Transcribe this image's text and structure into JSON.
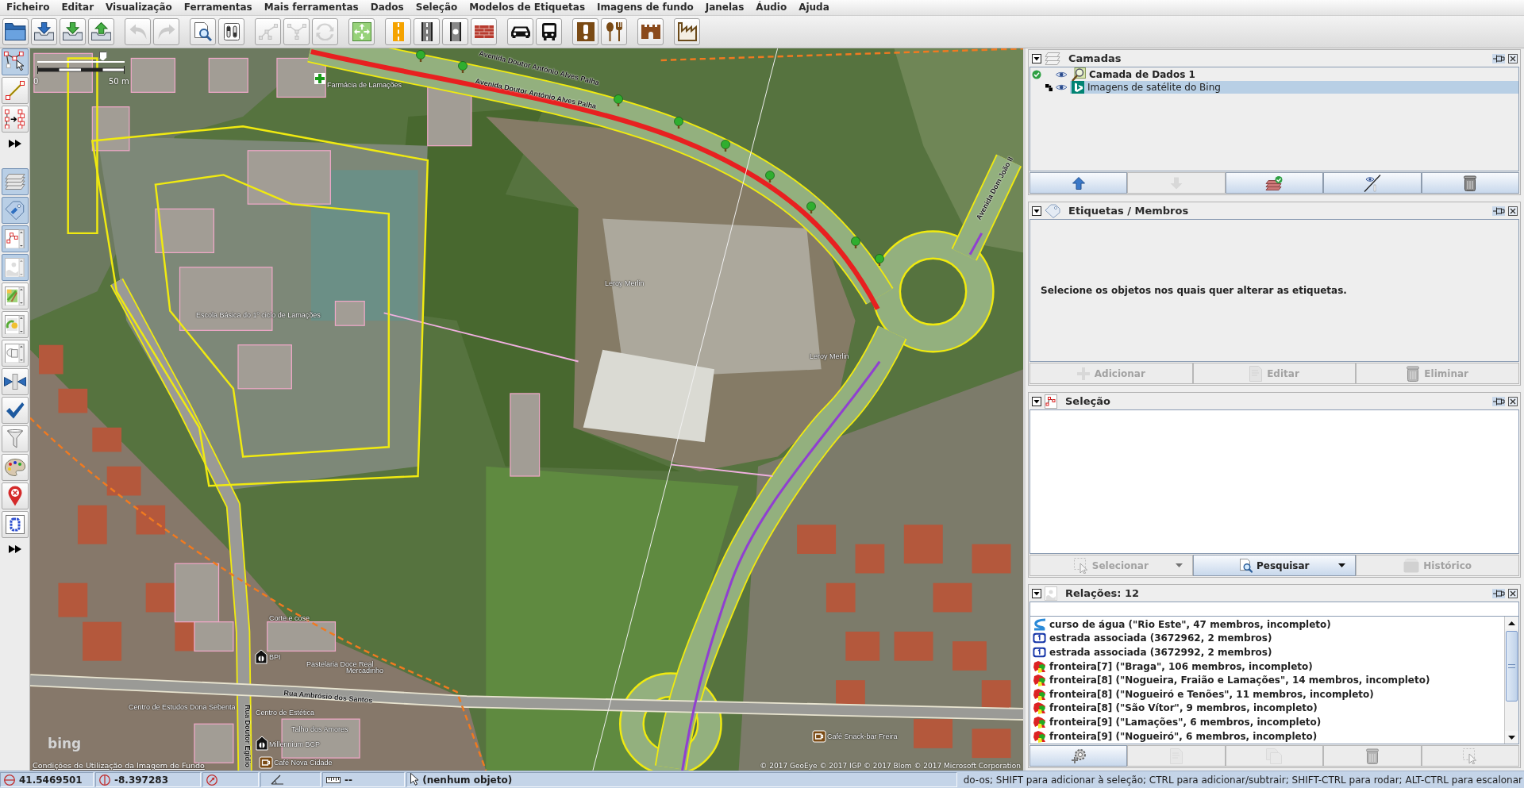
{
  "menu": [
    "Ficheiro",
    "Editar",
    "Visualização",
    "Ferramentas",
    "Mais ferramentas",
    "Dados",
    "Seleção",
    "Modelos de Etiquetas",
    "Imagens de fundo",
    "Janelas",
    "Áudio",
    "Ajuda"
  ],
  "toolbar": {
    "groups": [
      [
        {
          "disabled": false
        },
        {
          "disabled": false
        },
        {
          "disabled": false
        },
        {
          "disabled": false
        }
      ],
      [
        {
          "disabled": true
        },
        {
          "disabled": true
        }
      ],
      [
        {
          "disabled": false
        },
        {
          "disabled": false
        }
      ],
      [
        {
          "disabled": true
        },
        {
          "disabled": true
        },
        {
          "disabled": true
        }
      ],
      [
        {
          "disabled": false
        }
      ],
      [
        {
          "disabled": false
        },
        {
          "disabled": false
        },
        {
          "disabled": false
        },
        {
          "disabled": false
        }
      ],
      [
        {
          "disabled": false
        },
        {
          "disabled": false
        }
      ],
      [
        {
          "disabled": false
        },
        {
          "disabled": false
        }
      ],
      [
        {
          "disabled": false
        }
      ],
      [
        {
          "disabled": false
        }
      ]
    ]
  },
  "side_toolbar": {
    "modes": [
      {
        "selected": true
      },
      {
        "selected": false
      },
      {
        "selected": false
      }
    ],
    "panels": [
      {
        "on": true
      },
      {
        "on": true
      },
      {
        "on": true
      },
      {
        "on": true
      },
      {
        "on": false
      },
      {
        "on": false
      },
      {
        "on": false
      },
      {
        "on": false
      },
      {
        "on": false
      },
      {
        "on": false
      },
      {
        "on": false
      },
      {
        "on": false
      },
      {
        "on": false
      }
    ]
  },
  "map": {
    "zoom_slider": {
      "level": 0.75
    },
    "scale_start": "0",
    "scale_end": "50 m",
    "labels": [
      {
        "kind": "road",
        "text": "Avenida Doutor António Alves Palha"
      },
      {
        "kind": "road",
        "text": "Avenida Doutor António Alves Palha"
      },
      {
        "kind": "poi",
        "text": "Farmácia de Lamações"
      },
      {
        "kind": "poi",
        "text": "Escola Básica do 1º ciclo de Lamações"
      },
      {
        "kind": "poi",
        "text": "Leroy Merlin"
      },
      {
        "kind": "poi",
        "text": "Leroy Merlin"
      },
      {
        "kind": "road",
        "text": "Avenida Dom João II"
      },
      {
        "kind": "road",
        "text": "Rua Ambrósio dos Santos"
      },
      {
        "kind": "poi",
        "text": "Corte e cose"
      },
      {
        "kind": "poi",
        "text": "BPI"
      },
      {
        "kind": "poi",
        "text": "Pastelaria Doce Real"
      },
      {
        "kind": "poi",
        "text": "Mercadinho"
      },
      {
        "kind": "poi",
        "text": "Centro de Estudos Dona Sebenta"
      },
      {
        "kind": "poi",
        "text": "Centro de Estética"
      },
      {
        "kind": "road",
        "text": "Rua Doutor Egídio"
      },
      {
        "kind": "poi",
        "text": "Talho dos Amores"
      },
      {
        "kind": "poi",
        "text": "Millennium BCP"
      },
      {
        "kind": "poi",
        "text": "Café Nova Cidade"
      },
      {
        "kind": "poi",
        "text": "Café Snack-bar Freira"
      }
    ],
    "imagery_logo": "bing",
    "terms_link": "Condições de Utilização da Imagem de Fundo",
    "attribution": "© 2017 GeoEye © 2017 IGP © 2017 Blom © 2017 Microsoft Corporation"
  },
  "layers_panel": {
    "title": "Camadas",
    "layers": [
      {
        "kind": "data",
        "name": "Camada de Dados 1",
        "active": true,
        "visible": true,
        "selected": false
      },
      {
        "kind": "imagery",
        "name": "Imagens de satélite do Bing",
        "active": false,
        "visible": true,
        "selected": true
      }
    ],
    "buttons": [
      {
        "disabled": false
      },
      {
        "disabled": true
      },
      {
        "disabled": false
      },
      {
        "disabled": false
      },
      {
        "disabled": false
      }
    ]
  },
  "tags_panel": {
    "title": "Etiquetas / Membros",
    "message": "Selecione os objetos nos quais quer alterar as etiquetas.",
    "buttons": [
      {
        "label": "Adicionar",
        "disabled": true
      },
      {
        "label": "Editar",
        "disabled": true
      },
      {
        "label": "Eliminar",
        "disabled": true
      }
    ]
  },
  "selection_panel": {
    "title": "Seleção",
    "buttons": [
      {
        "label": "Selecionar",
        "disabled": true,
        "dropdown": true
      },
      {
        "label": "Pesquisar",
        "disabled": false,
        "dropdown": true
      },
      {
        "label": "Histórico",
        "disabled": true,
        "dropdown": false
      }
    ]
  },
  "relations_panel": {
    "title": "Relações: 12",
    "items": [
      {
        "kind": "waterway",
        "label": "curso de água (\"Rio Este\", 47 membros, incompleto)",
        "selected": false
      },
      {
        "kind": "route",
        "label": "estrada associada (3672962, 2 membros)",
        "selected": false
      },
      {
        "kind": "route",
        "label": "estrada associada (3672992, 2 membros)",
        "selected": false
      },
      {
        "kind": "boundary",
        "label": "fronteira[7] (\"Braga\", 106 membros, incompleto)",
        "selected": false
      },
      {
        "kind": "boundary",
        "label": "fronteira[8] (\"Nogueira, Fraião e Lamações\", 14 membros, incompleto)",
        "selected": false
      },
      {
        "kind": "boundary",
        "label": "fronteira[8] (\"Nogueiró e Tenões\", 11 membros, incompleto)",
        "selected": false
      },
      {
        "kind": "boundary",
        "label": "fronteira[8] (\"São Vítor\", 9 membros, incompleto)",
        "selected": false
      },
      {
        "kind": "boundary",
        "label": "fronteira[9] (\"Lamações\", 6 membros, incompleto)",
        "selected": false
      },
      {
        "kind": "boundary",
        "label": "fronteira[9] (\"Nogueiró\", 6 membros, incompleto)",
        "selected": false
      }
    ],
    "buttons": [
      {
        "disabled": false
      },
      {
        "disabled": true
      },
      {
        "disabled": true
      },
      {
        "disabled": true
      },
      {
        "disabled": true
      }
    ]
  },
  "status_bar": {
    "latitude": "41.5469501",
    "longitude": "-8.397283",
    "distance": "--",
    "selection": "(nenhum objeto)",
    "help": "do-os; SHIFT para adicionar à seleção; CTRL para adicionar/subtrair; SHIFT-CTRL para rodar; ALT-CTRL para escalonar"
  }
}
